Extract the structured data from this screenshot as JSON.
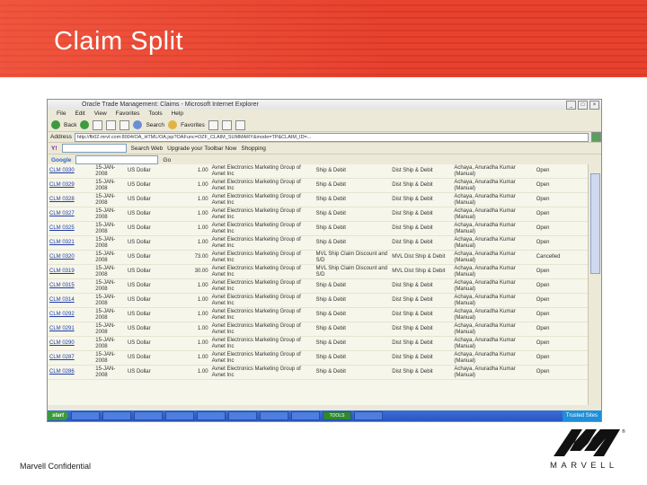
{
  "slide": {
    "title": "Claim Split",
    "footer": "Marvell Confidential",
    "logo_text": "MARVELL",
    "colors": {
      "band": "#e8422f",
      "link": "#1f3ca8"
    }
  },
  "browser": {
    "window_title": "Oracle Trade Management: Claims - Microsoft Internet Explorer",
    "menu": [
      "File",
      "Edit",
      "View",
      "Favorites",
      "Tools",
      "Help"
    ],
    "toolbar": {
      "back": "Back",
      "search": "Search",
      "favorites": "Favorites"
    },
    "address": {
      "label": "Address",
      "url": "http://fb02.mrvl.com:8004/OA_HTML/OA.jsp?OAFunc=OZF_CLAIM_SUMMARY&mode=TP&CLAIM_ID=..."
    },
    "yahoo_bar": {
      "search_label": "Search Web",
      "upgrade": "Upgrade your Toolbar Now",
      "shopping": "Shopping"
    },
    "google_bar": {
      "label": "Google",
      "go": "Go"
    }
  },
  "claims": {
    "rows": [
      {
        "claim": "CLM 0330",
        "date": "15-JAN-2008",
        "currency": "US Dollar",
        "amount": "1.00",
        "customer": "Avnet Electronics Marketing Group of Avnet Inc",
        "type": "Ship & Debit",
        "deduction": "Dist Ship & Debit",
        "owner": "Achaya, Anuradha Kumar (Manual)",
        "status": "Open"
      },
      {
        "claim": "CLM 0329",
        "date": "15-JAN-2008",
        "currency": "US Dollar",
        "amount": "1.00",
        "customer": "Avnet Electronics Marketing Group of Avnet Inc",
        "type": "Ship & Debit",
        "deduction": "Dist Ship & Debit",
        "owner": "Achaya, Anuradha Kumar (Manual)",
        "status": "Open"
      },
      {
        "claim": "CLM 0328",
        "date": "15-JAN-2008",
        "currency": "US Dollar",
        "amount": "1.00",
        "customer": "Avnet Electronics Marketing Group of Avnet Inc",
        "type": "Ship & Debit",
        "deduction": "Dist Ship & Debit",
        "owner": "Achaya, Anuradha Kumar (Manual)",
        "status": "Open"
      },
      {
        "claim": "CLM 0327",
        "date": "15-JAN-2008",
        "currency": "US Dollar",
        "amount": "1.00",
        "customer": "Avnet Electronics Marketing Group of Avnet Inc",
        "type": "Ship & Debit",
        "deduction": "Dist Ship & Debit",
        "owner": "Achaya, Anuradha Kumar (Manual)",
        "status": "Open"
      },
      {
        "claim": "CLM 0325",
        "date": "15-JAN-2008",
        "currency": "US Dollar",
        "amount": "1.00",
        "customer": "Avnet Electronics Marketing Group of Avnet Inc",
        "type": "Ship & Debit",
        "deduction": "Dist Ship & Debit",
        "owner": "Achaya, Anuradha Kumar (Manual)",
        "status": "Open"
      },
      {
        "claim": "CLM 0321",
        "date": "15-JAN-2008",
        "currency": "US Dollar",
        "amount": "1.00",
        "customer": "Avnet Electronics Marketing Group of Avnet Inc",
        "type": "Ship & Debit",
        "deduction": "Dist Ship & Debit",
        "owner": "Achaya, Anuradha Kumar (Manual)",
        "status": "Open"
      },
      {
        "claim": "CLM 0320",
        "date": "15-JAN-2008",
        "currency": "US Dollar",
        "amount": "73.00",
        "customer": "Avnet Electronics Marketing Group of Avnet Inc",
        "type": "MVL Ship Claim Discount and S/D",
        "deduction": "MVL Dist Ship & Debit",
        "owner": "Achaya, Anuradha Kumar (Manual)",
        "status": "Cancelled"
      },
      {
        "claim": "CLM 0319",
        "date": "15-JAN-2008",
        "currency": "US Dollar",
        "amount": "30.00",
        "customer": "Avnet Electronics Marketing Group of Avnet Inc",
        "type": "MVL Ship Claim Discount and S/D",
        "deduction": "MVL Dist Ship & Debit",
        "owner": "Achaya, Anuradha Kumar (Manual)",
        "status": "Open"
      },
      {
        "claim": "CLM 0315",
        "date": "15-JAN-2008",
        "currency": "US Dollar",
        "amount": "1.00",
        "customer": "Avnet Electronics Marketing Group of Avnet Inc",
        "type": "Ship & Debit",
        "deduction": "Dist Ship & Debit",
        "owner": "Achaya, Anuradha Kumar (Manual)",
        "status": "Open"
      },
      {
        "claim": "CLM 0314",
        "date": "15-JAN-2008",
        "currency": "US Dollar",
        "amount": "1.00",
        "customer": "Avnet Electronics Marketing Group of Avnet Inc",
        "type": "Ship & Debit",
        "deduction": "Dist Ship & Debit",
        "owner": "Achaya, Anuradha Kumar (Manual)",
        "status": "Open"
      },
      {
        "claim": "CLM 0292",
        "date": "15-JAN-2008",
        "currency": "US Dollar",
        "amount": "1.00",
        "customer": "Avnet Electronics Marketing Group of Avnet Inc",
        "type": "Ship & Debit",
        "deduction": "Dist Ship & Debit",
        "owner": "Achaya, Anuradha Kumar (Manual)",
        "status": "Open"
      },
      {
        "claim": "CLM 0291",
        "date": "15-JAN-2008",
        "currency": "US Dollar",
        "amount": "1.00",
        "customer": "Avnet Electronics Marketing Group of Avnet Inc",
        "type": "Ship & Debit",
        "deduction": "Dist Ship & Debit",
        "owner": "Achaya, Anuradha Kumar (Manual)",
        "status": "Open"
      },
      {
        "claim": "CLM 0290",
        "date": "15-JAN-2008",
        "currency": "US Dollar",
        "amount": "1.00",
        "customer": "Avnet Electronics Marketing Group of Avnet Inc",
        "type": "Ship & Debit",
        "deduction": "Dist Ship & Debit",
        "owner": "Achaya, Anuradha Kumar (Manual)",
        "status": "Open"
      },
      {
        "claim": "CLM 0287",
        "date": "15-JAN-2008",
        "currency": "US Dollar",
        "amount": "1.00",
        "customer": "Avnet Electronics Marketing Group of Avnet Inc",
        "type": "Ship & Debit",
        "deduction": "Dist Ship & Debit",
        "owner": "Achaya, Anuradha Kumar (Manual)",
        "status": "Open"
      },
      {
        "claim": "CLM 0286",
        "date": "15-JAN-2008",
        "currency": "US Dollar",
        "amount": "1.00",
        "customer": "Avnet Electronics Marketing Group of Avnet Inc",
        "type": "Ship & Debit",
        "deduction": "Dist Ship & Debit",
        "owner": "Achaya, Anuradha Kumar (Manual)",
        "status": "Open"
      }
    ]
  },
  "taskbar": {
    "start": "start",
    "active_task": "TOOLS",
    "tray": "Trusted Sites"
  }
}
